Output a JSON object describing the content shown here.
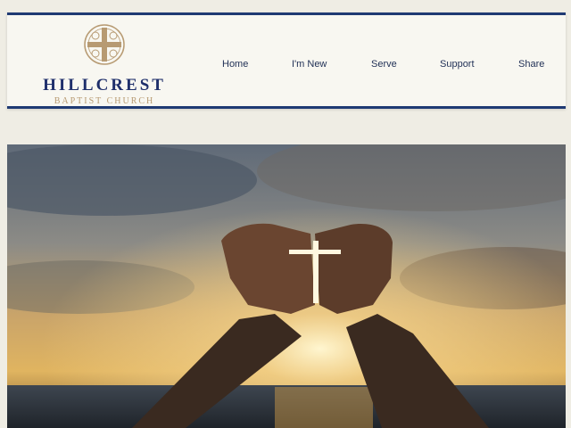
{
  "site": {
    "name": "HILLCREST",
    "subtitle": "BAPTIST CHURCH"
  },
  "nav": {
    "items": [
      {
        "label": "Home"
      },
      {
        "label": "I'm New"
      },
      {
        "label": "Serve"
      },
      {
        "label": "Support"
      },
      {
        "label": "Share"
      }
    ]
  },
  "colors": {
    "primary": "#1f3a73",
    "accent": "#b79a72",
    "background": "#efede4"
  },
  "icons": {
    "logo": "cross-emblem-icon"
  }
}
